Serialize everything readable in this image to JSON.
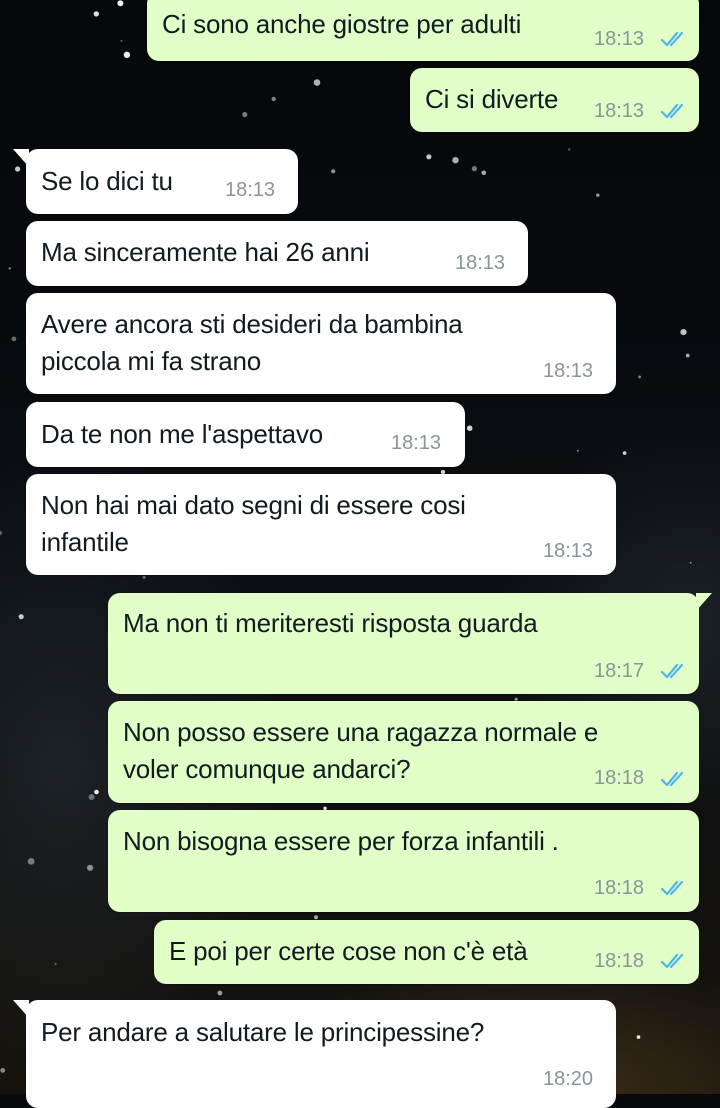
{
  "colors": {
    "incoming_bubble": "#ffffff",
    "outgoing_bubble": "#e1ffc7",
    "timestamp": "#8a9599",
    "read_ticks": "#4fb6ec",
    "message_text": "#111b21"
  },
  "messages": [
    {
      "direction": "outgoing",
      "lines": [
        "Ci sono anche giostre per adulti"
      ],
      "time": "18:13",
      "status": "read-double-check-icon"
    },
    {
      "direction": "outgoing",
      "lines": [
        "Ci si diverte"
      ],
      "time": "18:13",
      "status": "read-double-check-icon"
    },
    {
      "direction": "incoming",
      "lines": [
        "Se lo dici tu"
      ],
      "time": "18:13"
    },
    {
      "direction": "incoming",
      "lines": [
        "Ma sinceramente hai 26 anni"
      ],
      "time": "18:13"
    },
    {
      "direction": "incoming",
      "lines": [
        "Avere ancora sti desideri da bambina",
        "piccola mi fa strano"
      ],
      "time": "18:13"
    },
    {
      "direction": "incoming",
      "lines": [
        "Da te non me l'aspettavo"
      ],
      "time": "18:13"
    },
    {
      "direction": "incoming",
      "lines": [
        "Non hai mai dato segni di essere cosi",
        "infantile"
      ],
      "time": "18:13"
    },
    {
      "direction": "outgoing",
      "lines": [
        "Ma non ti meriteresti risposta guarda"
      ],
      "time": "18:17",
      "status": "read-double-check-icon"
    },
    {
      "direction": "outgoing",
      "lines": [
        "Non posso essere una ragazza normale e",
        "voler comunque andarci?"
      ],
      "time": "18:18",
      "status": "read-double-check-icon"
    },
    {
      "direction": "outgoing",
      "lines": [
        "Non bisogna essere per forza infantili ."
      ],
      "time": "18:18",
      "status": "read-double-check-icon"
    },
    {
      "direction": "outgoing",
      "lines": [
        "E poi per certe cose non c'è età"
      ],
      "time": "18:18",
      "status": "read-double-check-icon"
    },
    {
      "direction": "incoming",
      "lines": [
        "Per andare a salutare le principessine?"
      ],
      "time": "18:20"
    }
  ]
}
